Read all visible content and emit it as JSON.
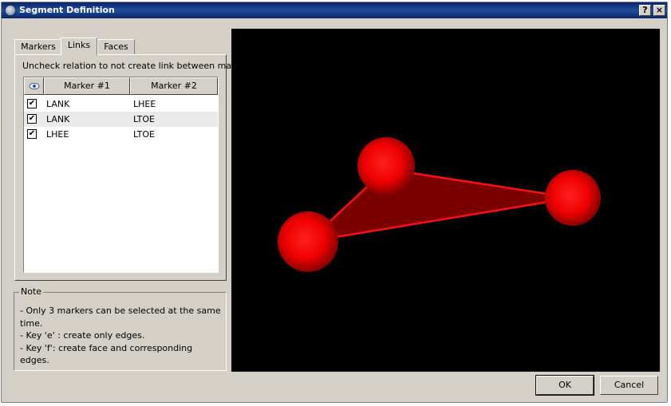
{
  "window": {
    "title": "Segment Definition",
    "help_label": "?",
    "close_label": "×"
  },
  "tabs": [
    {
      "label": "Markers",
      "active": false
    },
    {
      "label": "Links",
      "active": true
    },
    {
      "label": "Faces",
      "active": false
    }
  ],
  "links_panel": {
    "hint": "Uncheck relation to not create link between markers.",
    "columns": {
      "visibility_icon": "eye-icon",
      "marker1": "Marker #1",
      "marker2": "Marker #2"
    },
    "rows": [
      {
        "checked": true,
        "marker1": "LANK",
        "marker2": "LHEE"
      },
      {
        "checked": true,
        "marker1": "LANK",
        "marker2": "LTOE"
      },
      {
        "checked": true,
        "marker1": "LHEE",
        "marker2": "LTOE"
      }
    ]
  },
  "note": {
    "legend": "Note",
    "lines": [
      "- Only 3 markers can be selected at the same time.",
      "- Key 'e' : create only edges.",
      "- Key 'f': create face and corresponding edges."
    ]
  },
  "viewport": {
    "background": "#000000",
    "marker_color": "#ff0000",
    "face_color": "#7a0000"
  },
  "buttons": {
    "ok": "OK",
    "cancel": "Cancel"
  }
}
